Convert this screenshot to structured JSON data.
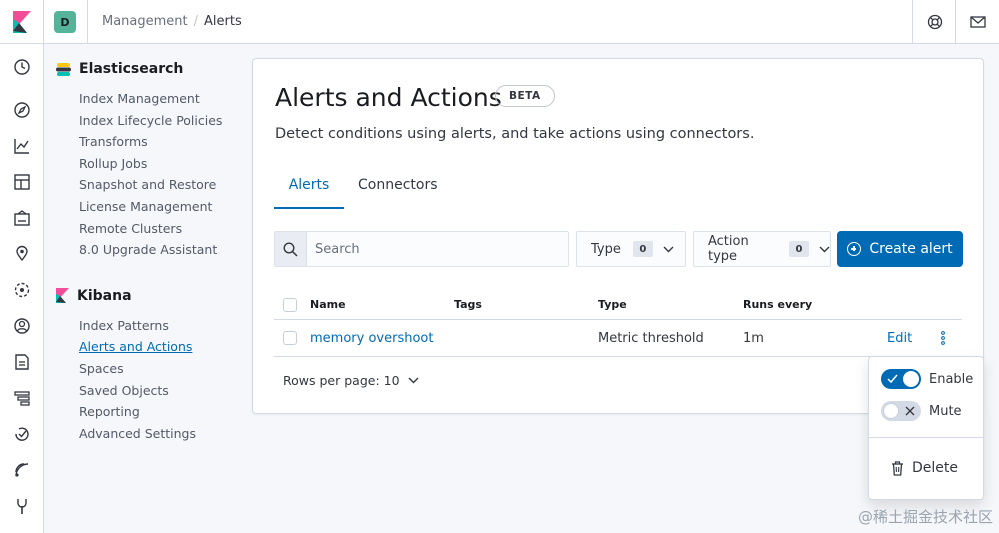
{
  "header": {
    "space_initial": "D",
    "breadcrumbs": [
      "Management",
      "Alerts"
    ],
    "breadcrumb_separator": "/"
  },
  "nav_rail": {
    "icons": [
      "recent-icon",
      "discover-icon",
      "visualize-icon",
      "dashboard-icon",
      "canvas-icon",
      "maps-icon",
      "ml-icon",
      "infrastructure-icon",
      "logs-icon",
      "apm-icon",
      "uptime-icon",
      "siem-icon",
      "dev-tools-icon"
    ]
  },
  "sidebar": {
    "elasticsearch": {
      "title": "Elasticsearch",
      "items": [
        "Index Management",
        "Index Lifecycle Policies",
        "Transforms",
        "Rollup Jobs",
        "Snapshot and Restore",
        "License Management",
        "Remote Clusters",
        "8.0 Upgrade Assistant"
      ]
    },
    "kibana": {
      "title": "Kibana",
      "items": [
        "Index Patterns",
        "Alerts and Actions",
        "Spaces",
        "Saved Objects",
        "Reporting",
        "Advanced Settings"
      ],
      "active": "Alerts and Actions"
    }
  },
  "main": {
    "title": "Alerts and Actions",
    "badge": "BETA",
    "description": "Detect conditions using alerts, and take actions using connectors.",
    "tabs": [
      "Alerts",
      "Connectors"
    ],
    "active_tab": "Alerts",
    "search_placeholder": "Search",
    "filters": [
      {
        "label": "Type",
        "count": "0"
      },
      {
        "label": "Action type",
        "count": "0"
      }
    ],
    "create_button": "Create alert",
    "table": {
      "columns": [
        "Name",
        "Tags",
        "Type",
        "Runs every"
      ],
      "rows": [
        {
          "name": "memory overshoot",
          "tags": "",
          "type": "Metric threshold",
          "interval": "1m",
          "action": "Edit"
        }
      ]
    },
    "rows_per_page": "Rows per page: 10"
  },
  "popover": {
    "enable_label": "Enable",
    "enable_on": true,
    "mute_label": "Mute",
    "mute_on": false,
    "delete_label": "Delete"
  },
  "watermark": "@稀土掘金技术社区",
  "colors": {
    "primary": "#006bb4",
    "space_avatar": "#54b399",
    "border": "#d3dae6"
  }
}
